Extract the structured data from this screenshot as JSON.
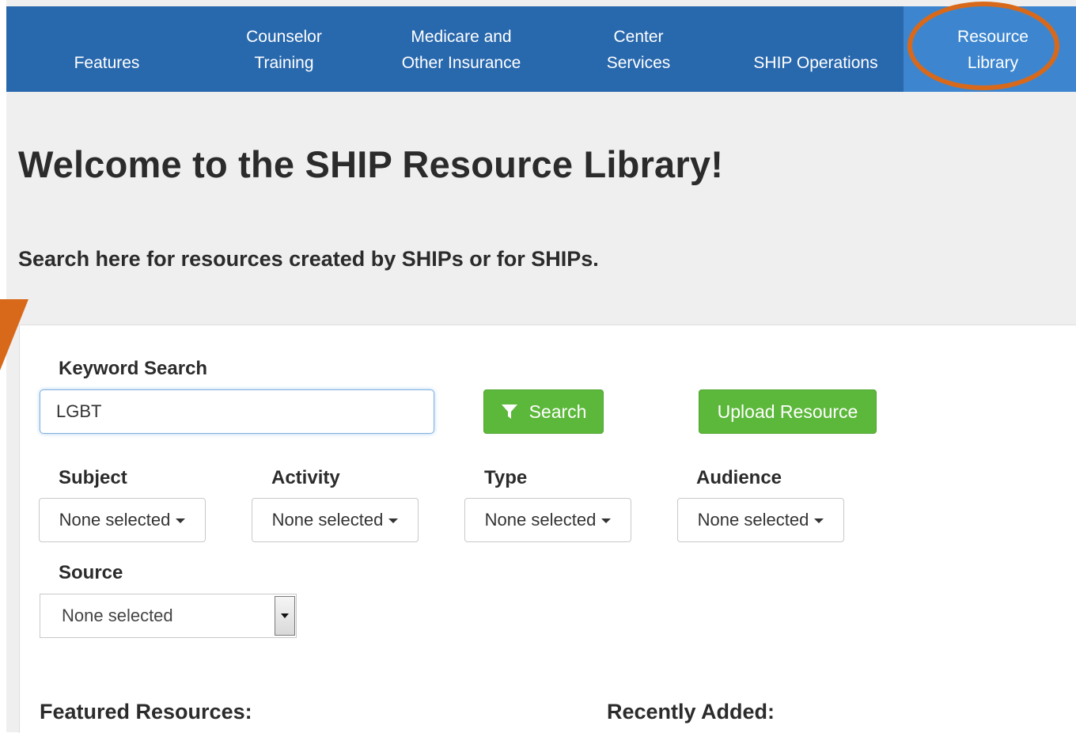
{
  "nav": {
    "items": [
      {
        "line1": "",
        "line2": "Features"
      },
      {
        "line1": "Counselor",
        "line2": "Training"
      },
      {
        "line1": "Medicare and",
        "line2": "Other Insurance"
      },
      {
        "line1": "Center",
        "line2": "Services"
      },
      {
        "line1": "",
        "line2": "SHIP Operations"
      },
      {
        "line1": "Resource",
        "line2": "Library"
      }
    ]
  },
  "page": {
    "title": "Welcome to the SHIP Resource Library!",
    "subtitle": "Search here for resources created by SHIPs or for SHIPs."
  },
  "search": {
    "keyword_label": "Keyword Search",
    "keyword_value": "LGBT",
    "search_button": "Search",
    "upload_button": "Upload Resource"
  },
  "filters": {
    "subject_label": "Subject",
    "subject_value": "None selected",
    "activity_label": "Activity",
    "activity_value": "None selected",
    "type_label": "Type",
    "type_value": "None selected",
    "audience_label": "Audience",
    "audience_value": "None selected",
    "source_label": "Source",
    "source_value": "None selected"
  },
  "sections": {
    "featured": "Featured Resources:",
    "recent": "Recently Added:"
  },
  "colors": {
    "nav_bg": "#2868ad",
    "nav_active": "#3d86cf",
    "button_green": "#5cb83b",
    "annotation_orange": "#d9691a"
  }
}
